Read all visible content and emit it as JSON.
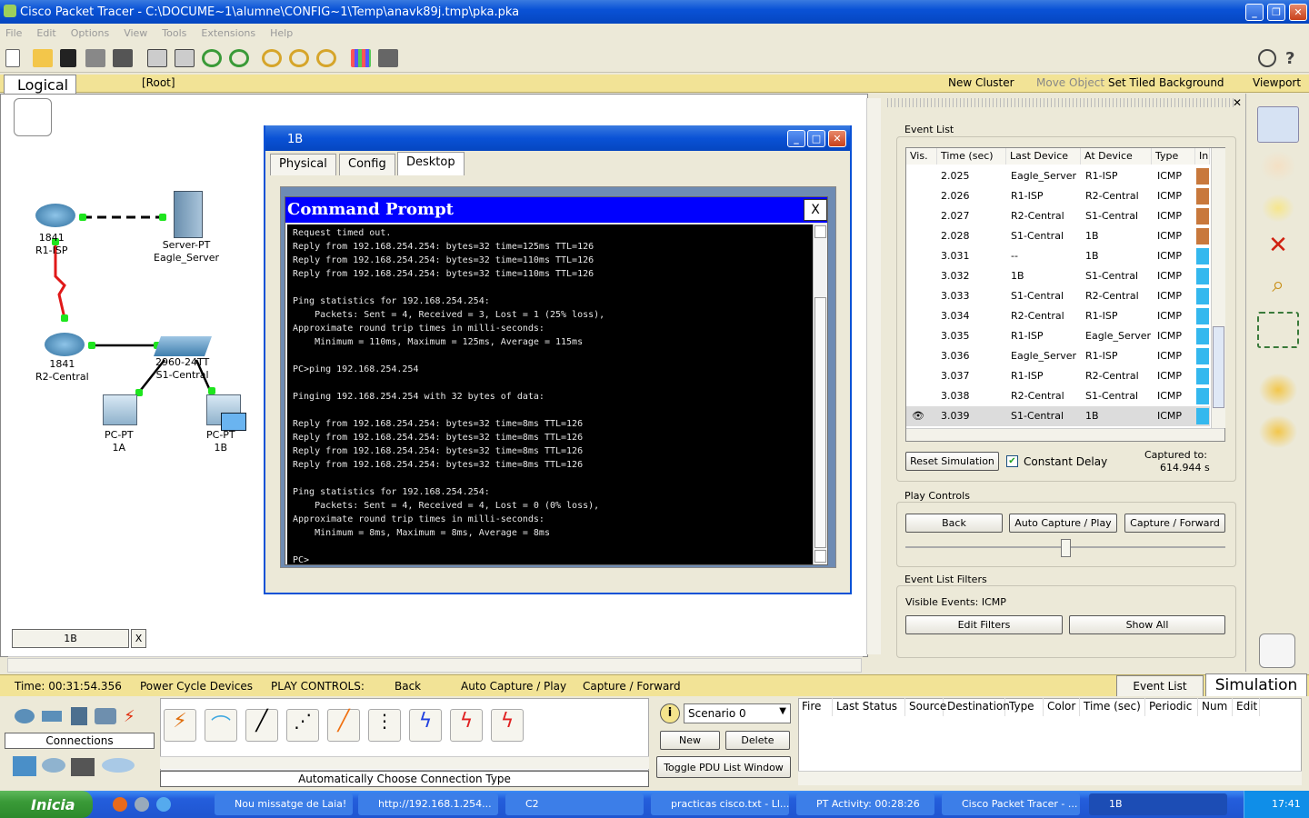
{
  "window": {
    "title": "Cisco Packet Tracer - C:\\DOCUME~1\\alumne\\CONFIG~1\\Temp\\anavk89j.tmp\\pka.pka"
  },
  "menu": [
    "File",
    "Edit",
    "Options",
    "View",
    "Tools",
    "Extensions",
    "Help"
  ],
  "workspace": {
    "tab": "Logical",
    "root": "[Root]",
    "new_cluster": "New Cluster",
    "move_object": "Move Object",
    "set_tiled_bg": "Set Tiled Background",
    "viewport": "Viewport"
  },
  "devices": [
    {
      "model": "1841",
      "name": "R1-ISP"
    },
    {
      "model": "Server-PT",
      "name": "Eagle_Server"
    },
    {
      "model": "1841",
      "name": "R2-Central"
    },
    {
      "model": "2960-24TT",
      "name": "S1-Central"
    },
    {
      "model": "PC-PT",
      "name": "1A"
    },
    {
      "model": "PC-PT",
      "name": "1B"
    }
  ],
  "canvas_bottom": {
    "field": "1B",
    "x": "X"
  },
  "dialog": {
    "title": "1B",
    "tabs": [
      "Physical",
      "Config",
      "Desktop"
    ],
    "cmd_title": "Command Prompt",
    "cmd_close": "X",
    "cmd_lines": [
      "Request timed out.",
      "Reply from 192.168.254.254: bytes=32 time=125ms TTL=126",
      "Reply from 192.168.254.254: bytes=32 time=110ms TTL=126",
      "Reply from 192.168.254.254: bytes=32 time=110ms TTL=126",
      "",
      "Ping statistics for 192.168.254.254:",
      "    Packets: Sent = 4, Received = 3, Lost = 1 (25% loss),",
      "Approximate round trip times in milli-seconds:",
      "    Minimum = 110ms, Maximum = 125ms, Average = 115ms",
      "",
      "PC>ping 192.168.254.254",
      "",
      "Pinging 192.168.254.254 with 32 bytes of data:",
      "",
      "Reply from 192.168.254.254: bytes=32 time=8ms TTL=126",
      "Reply from 192.168.254.254: bytes=32 time=8ms TTL=126",
      "Reply from 192.168.254.254: bytes=32 time=8ms TTL=126",
      "Reply from 192.168.254.254: bytes=32 time=8ms TTL=126",
      "",
      "Ping statistics for 192.168.254.254:",
      "    Packets: Sent = 4, Received = 4, Lost = 0 (0% loss),",
      "Approximate round trip times in milli-seconds:",
      "    Minimum = 8ms, Maximum = 8ms, Average = 8ms",
      "",
      "PC>"
    ]
  },
  "event_list": {
    "title": "Event List",
    "headers": [
      "Vis.",
      "Time (sec)",
      "Last Device",
      "At Device",
      "Type",
      "In"
    ],
    "rows": [
      {
        "time": "2.025",
        "last": "Eagle_Server",
        "at": "R1-ISP",
        "type": "ICMP",
        "color": "#c8783c"
      },
      {
        "time": "2.026",
        "last": "R1-ISP",
        "at": "R2-Central",
        "type": "ICMP",
        "color": "#c8783c"
      },
      {
        "time": "2.027",
        "last": "R2-Central",
        "at": "S1-Central",
        "type": "ICMP",
        "color": "#c8783c"
      },
      {
        "time": "2.028",
        "last": "S1-Central",
        "at": "1B",
        "type": "ICMP",
        "color": "#c8783c"
      },
      {
        "time": "3.031",
        "last": "--",
        "at": "1B",
        "type": "ICMP",
        "color": "#34b8ee"
      },
      {
        "time": "3.032",
        "last": "1B",
        "at": "S1-Central",
        "type": "ICMP",
        "color": "#34b8ee"
      },
      {
        "time": "3.033",
        "last": "S1-Central",
        "at": "R2-Central",
        "type": "ICMP",
        "color": "#34b8ee"
      },
      {
        "time": "3.034",
        "last": "R2-Central",
        "at": "R1-ISP",
        "type": "ICMP",
        "color": "#34b8ee"
      },
      {
        "time": "3.035",
        "last": "R1-ISP",
        "at": "Eagle_Server",
        "type": "ICMP",
        "color": "#34b8ee"
      },
      {
        "time": "3.036",
        "last": "Eagle_Server",
        "at": "R1-ISP",
        "type": "ICMP",
        "color": "#34b8ee"
      },
      {
        "time": "3.037",
        "last": "R1-ISP",
        "at": "R2-Central",
        "type": "ICMP",
        "color": "#34b8ee"
      },
      {
        "time": "3.038",
        "last": "R2-Central",
        "at": "S1-Central",
        "type": "ICMP",
        "color": "#34b8ee"
      },
      {
        "time": "3.039",
        "last": "S1-Central",
        "at": "1B",
        "type": "ICMP",
        "color": "#34b8ee"
      }
    ],
    "reset": "Reset Simulation",
    "constant_delay": "Constant Delay",
    "captured_label": "Captured to:",
    "captured_value": "614.944 s"
  },
  "play_controls": {
    "title": "Play Controls",
    "back": "Back",
    "auto": "Auto Capture / Play",
    "forward": "Capture / Forward"
  },
  "filters": {
    "title": "Event List Filters",
    "visible": "Visible Events:  ICMP",
    "edit": "Edit Filters",
    "show_all": "Show All"
  },
  "status": {
    "time": "Time: 00:31:54.356",
    "power": "Power Cycle Devices",
    "play": "PLAY CONTROLS:",
    "back": "Back",
    "auto": "Auto Capture / Play",
    "forward": "Capture / Forward",
    "event_list": "Event List",
    "simulation": "Simulation"
  },
  "connections": {
    "label": "Connections",
    "auto_type": "Automatically Choose Connection Type"
  },
  "scenario": {
    "value": "Scenario 0",
    "new": "New",
    "delete": "Delete",
    "toggle": "Toggle PDU List Window"
  },
  "pdu_headers": [
    "Fire",
    "Last Status",
    "Source",
    "Destination",
    "Type",
    "Color",
    "Time (sec)",
    "Periodic",
    "Num",
    "Edit"
  ],
  "taskbar": {
    "start": "Inicia",
    "tasks": [
      "Nou missatge de Laia!",
      "http://192.168.1.254...",
      "C2",
      "practicas cisco.txt - Ll...",
      "PT Activity: 00:28:26",
      "Cisco Packet Tracer - ...",
      "1B"
    ],
    "clock": "17:41"
  }
}
